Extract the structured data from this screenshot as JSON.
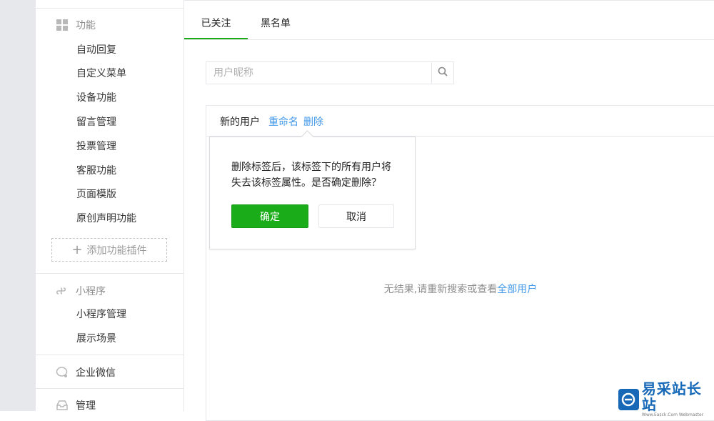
{
  "sidebar": {
    "sections": [
      {
        "icon": "grid-icon",
        "label": "功能",
        "items": [
          "自动回复",
          "自定义菜单",
          "设备功能",
          "留言管理",
          "投票管理",
          "客服功能",
          "页面模版",
          "原创声明功能"
        ]
      },
      {
        "icon": "mini-program-icon",
        "label": "小程序",
        "items": [
          "小程序管理",
          "展示场景"
        ]
      },
      {
        "icon": "wechat-work-icon",
        "label": "企业微信",
        "items": []
      },
      {
        "icon": "tray-icon",
        "label": "管理",
        "items": []
      }
    ],
    "add_plugin_label": "添加功能插件"
  },
  "tabs": [
    {
      "label": "已关注",
      "active": true
    },
    {
      "label": "黑名单",
      "active": false
    }
  ],
  "search": {
    "placeholder": "用户昵称"
  },
  "tag_panel": {
    "tag_name": "新的用户",
    "rename_link": "重命名",
    "delete_link": "删除",
    "empty_text": "无结果,请重新搜索或查看",
    "empty_link": "全部用户"
  },
  "popover": {
    "message_line1": "删除标签后，该标签下的所有用户将",
    "message_line2": "失去该标签属性。是否确定删除？",
    "confirm_label": "确定",
    "cancel_label": "取消"
  },
  "watermark": {
    "main": "易采站长站",
    "sub": "Www.Easck.Com Webmaster"
  },
  "colors": {
    "accent_green": "#1aad19",
    "link_blue": "#459ae9",
    "watermark_blue": "#1769b8"
  }
}
